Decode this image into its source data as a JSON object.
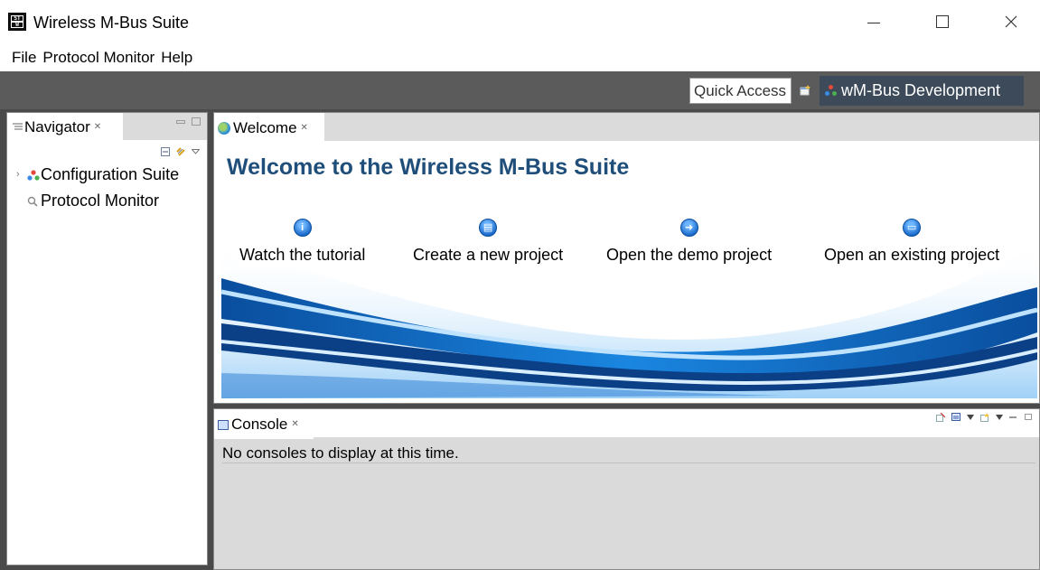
{
  "window": {
    "title": "Wireless M-Bus Suite",
    "logo_top": "ST",
    "logo_bottom": "W"
  },
  "menu": {
    "items": [
      "File",
      "Protocol Monitor",
      "Help"
    ]
  },
  "toolbar": {
    "quick_access": "Quick Access",
    "perspective_label": "wM-Bus Development"
  },
  "navigator": {
    "tab_label": "Navigator",
    "items": [
      {
        "label": "Configuration Suite",
        "icon": "multi-dot-icon",
        "expandable": true
      },
      {
        "label": "Protocol Monitor",
        "icon": "magnifier-icon",
        "expandable": false
      }
    ]
  },
  "editor": {
    "tab_label": "Welcome",
    "title": "Welcome to the Wireless M-Bus Suite",
    "actions": [
      {
        "label": "Watch the tutorial",
        "icon": "info-icon"
      },
      {
        "label": "Create a new project",
        "icon": "new-document-icon"
      },
      {
        "label": "Open the demo project",
        "icon": "arrow-right-icon"
      },
      {
        "label": "Open an existing project",
        "icon": "folder-icon"
      }
    ]
  },
  "console": {
    "tab_label": "Console",
    "message": "No consoles to display at this time."
  },
  "colors": {
    "title_blue": "#1f4e7a",
    "toolbar_gray": "#5b5b5b",
    "perspective_bg": "#3c4a5a",
    "wave_blue": "#0a64c8"
  }
}
